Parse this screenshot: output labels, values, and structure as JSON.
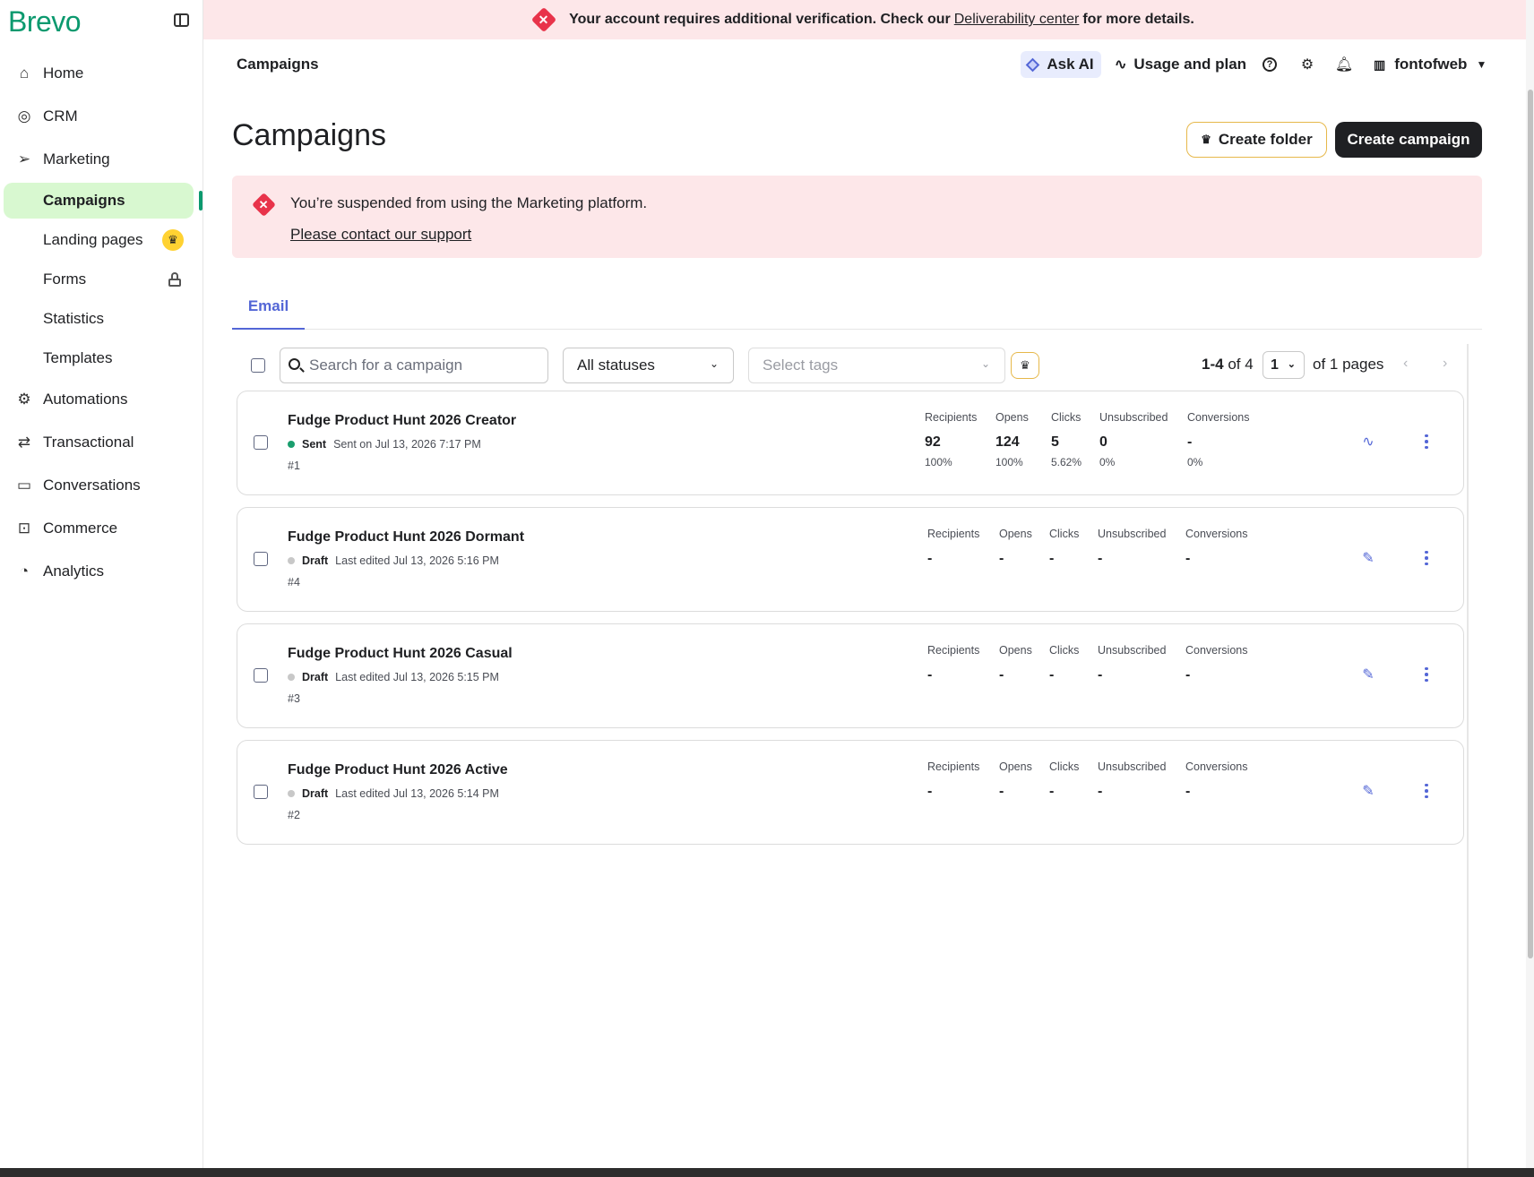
{
  "sidebar": {
    "logo": "Brevo",
    "items": [
      {
        "label": "Home",
        "icon": "home-icon"
      },
      {
        "label": "CRM",
        "icon": "contact-icon"
      },
      {
        "label": "Marketing",
        "icon": "send-icon"
      },
      {
        "label": "Automations",
        "icon": "automation-icon"
      },
      {
        "label": "Transactional",
        "icon": "transfer-icon"
      },
      {
        "label": "Conversations",
        "icon": "chat-icon"
      },
      {
        "label": "Commerce",
        "icon": "bag-icon"
      },
      {
        "label": "Analytics",
        "icon": "pie-chart-icon"
      }
    ],
    "marketing_sub": [
      {
        "label": "Campaigns",
        "active": true
      },
      {
        "label": "Landing pages",
        "badge": "crown-icon"
      },
      {
        "label": "Forms",
        "badge": "lock-icon"
      },
      {
        "label": "Statistics"
      },
      {
        "label": "Templates"
      }
    ]
  },
  "banner": {
    "text_before": "Your account requires additional verification. Check our",
    "link": "Deliverability center",
    "text_after": "for more details."
  },
  "header": {
    "title": "Campaigns",
    "ask_ai": "Ask AI",
    "usage": "Usage and plan",
    "org": "fontofweb"
  },
  "main": {
    "title": "Campaigns",
    "create_folder": "Create folder",
    "create_campaign": "Create campaign",
    "suspend_msg": "You’re suspended from using the Marketing platform.",
    "suspend_link": "Please contact our support",
    "tab": "Email"
  },
  "filters": {
    "search_placeholder": "Search for a campaign",
    "status": "All statuses",
    "tags_placeholder": "Select tags"
  },
  "pager": {
    "range": "1-4",
    "of_total": "of 4",
    "page": "1",
    "pages": "of 1 pages"
  },
  "stat_labels": {
    "recipients": "Recipients",
    "opens": "Opens",
    "clicks": "Clicks",
    "unsubscribed": "Unsubscribed",
    "conversions": "Conversions"
  },
  "campaigns": [
    {
      "name": "Fudge Product Hunt 2026 Creator",
      "status": "Sent",
      "status_color": "#1a9e6e",
      "date": "Sent on Jul 13, 2026 7:17 PM",
      "id": "#1",
      "recipients": "92",
      "recipients_pct": "100%",
      "opens": "124",
      "opens_pct": "100%",
      "clicks": "5",
      "clicks_pct": "5.62%",
      "unsubscribed": "0",
      "unsubscribed_pct": "0%",
      "conversions": "-",
      "conversions_pct": "0%",
      "action_icon": "activity-icon"
    },
    {
      "name": "Fudge Product Hunt 2026 Dormant",
      "status": "Draft",
      "status_color": "#c8c8c8",
      "date": "Last edited Jul 13, 2026 5:16 PM",
      "id": "#4",
      "recipients": "-",
      "opens": "-",
      "clicks": "-",
      "unsubscribed": "-",
      "conversions": "-",
      "action_icon": "pencil-icon"
    },
    {
      "name": "Fudge Product Hunt 2026 Casual",
      "status": "Draft",
      "status_color": "#c8c8c8",
      "date": "Last edited Jul 13, 2026 5:15 PM",
      "id": "#3",
      "recipients": "-",
      "opens": "-",
      "clicks": "-",
      "unsubscribed": "-",
      "conversions": "-",
      "action_icon": "pencil-icon"
    },
    {
      "name": "Fudge Product Hunt 2026 Active",
      "status": "Draft",
      "status_color": "#c8c8c8",
      "date": "Last edited Jul 13, 2026 5:14 PM",
      "id": "#2",
      "recipients": "-",
      "opens": "-",
      "clicks": "-",
      "unsubscribed": "-",
      "conversions": "-",
      "action_icon": "pencil-icon"
    }
  ]
}
